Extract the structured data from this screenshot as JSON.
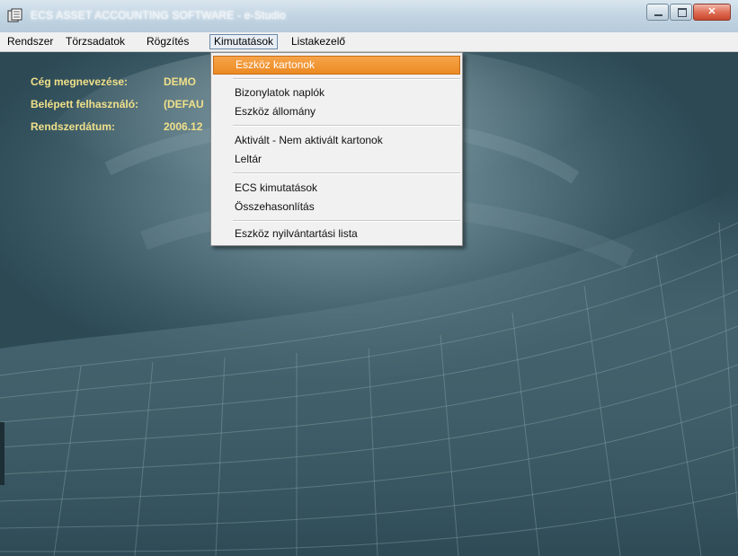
{
  "window": {
    "title": "ECS ASSET ACCOUNTING SOFTWARE - e-Studio",
    "buttons": {
      "minimize": "–",
      "maximize": "□",
      "close": "✕"
    }
  },
  "menubar": {
    "items": [
      {
        "label": "Rendszer"
      },
      {
        "label": "Törzsadatok"
      },
      {
        "label": "Rögzítés"
      },
      {
        "label": "Kimutatások"
      },
      {
        "label": "Listakezelő"
      }
    ]
  },
  "info": {
    "company_label": "Cég megnevezése:",
    "company_value": "DEMO",
    "user_label": "Belépett felhasználó:",
    "user_value": "(DEFAU",
    "date_label": "Rendszerdátum:",
    "date_value": "2006.12"
  },
  "dropdown": {
    "items": [
      {
        "label": "Eszköz kartonok",
        "selected": true
      },
      {
        "label": "Bizonylatok naplók"
      },
      {
        "label": "Eszköz állomány"
      },
      {
        "label": "Aktivált - Nem aktivált kartonok"
      },
      {
        "label": "Leltár"
      },
      {
        "label": "ECS kimutatások"
      },
      {
        "label": "Összehasonlítás"
      },
      {
        "label": "Eszköz nyilvántartási lista"
      }
    ]
  },
  "colors": {
    "highlight": "#ec8a23",
    "info_text": "#f0e08a",
    "background": "#3a5a66"
  }
}
